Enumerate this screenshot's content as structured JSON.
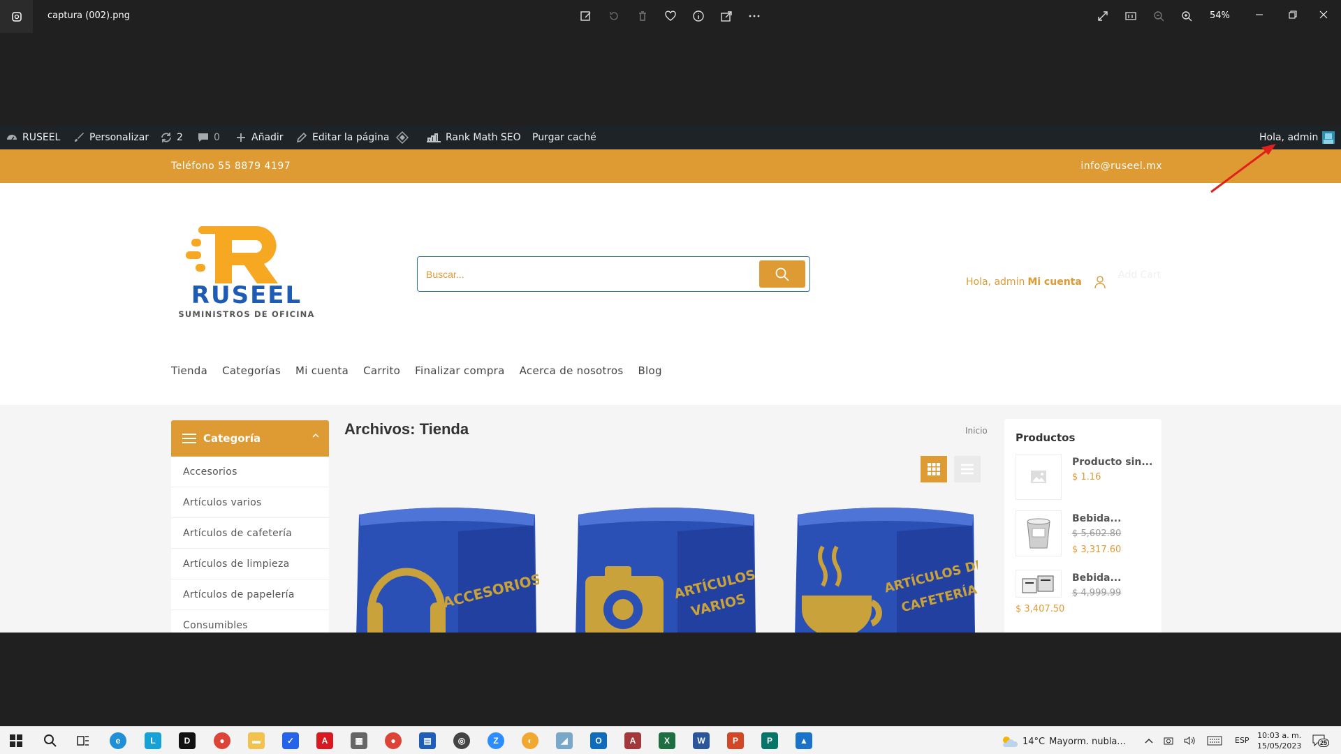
{
  "viewer": {
    "filename": "captura (002).png",
    "zoom": "54%",
    "tools": [
      "edit-image-icon",
      "rotate-icon",
      "delete-icon",
      "favorite-icon",
      "info-icon",
      "share-icon",
      "more-icon"
    ],
    "right_tools": [
      "fullscreen-icon",
      "actual-size-icon",
      "zoom-out-icon",
      "zoom-in-icon"
    ]
  },
  "admin_bar": {
    "site": "RUSEEL",
    "customize": "Personalizar",
    "updates": "2",
    "comments": "0",
    "add_new": "Añadir",
    "edit_page": "Editar la página",
    "rank_math": "Rank Math SEO",
    "purge_cache": "Purgar caché",
    "greeting": "Hola, admin"
  },
  "topbar": {
    "phone": "Teléfono 55 8879 4197",
    "email": "info@ruseel.mx"
  },
  "header": {
    "logo_name": "RUSEEL",
    "logo_tagline": "SUMINISTROS DE OFICINA",
    "search_placeholder": "Buscar...",
    "account_greeting": "Hola, admin",
    "account_link": "Mi cuenta",
    "add_cart": "Add Cart"
  },
  "nav": [
    "Tienda",
    "Categorías",
    "Mi cuenta",
    "Carrito",
    "Finalizar compra",
    "Acerca de nosotros",
    "Blog"
  ],
  "categories": {
    "title": "Categoría",
    "items": [
      "Accesorios",
      "Artículos varios",
      "Artículos de cafetería",
      "Artículos de limpieza",
      "Artículos de papelería",
      "Consumibles"
    ]
  },
  "main": {
    "heading": "Archivos: Tienda",
    "breadcrumb": "Inicio",
    "products": [
      {
        "label_line1": "ACCESORIOS",
        "label_line2": "",
        "icon": "headphones-icon"
      },
      {
        "label_line1": "ARTÍCULOS",
        "label_line2": "VARIOS",
        "icon": "camera-icon"
      },
      {
        "label_line1": "ARTÍCULOS DE",
        "label_line2": "CAFETERÍA",
        "icon": "coffee-cup-icon"
      }
    ]
  },
  "widget": {
    "title": "Productos",
    "items": [
      {
        "name": "Producto sin...",
        "old_price": "",
        "price": "$ 1.16"
      },
      {
        "name": "Bebida...",
        "old_price": "$ 5,602.80",
        "price": "$ 3,317.60"
      },
      {
        "name": "Bebida...",
        "old_price": "$ 4,999.99",
        "price": "$ 3,407.50"
      }
    ]
  },
  "taskbar": {
    "weather_temp": "14°C",
    "weather_desc": "Mayorm. nubla...",
    "lang": "ESP",
    "time": "10:03 a. m.",
    "date": "15/05/2023",
    "notifications": "25"
  },
  "colors": {
    "accent": "#de9a33",
    "admin_bar": "#1d2327",
    "brand_blue": "#1e5bb5"
  }
}
